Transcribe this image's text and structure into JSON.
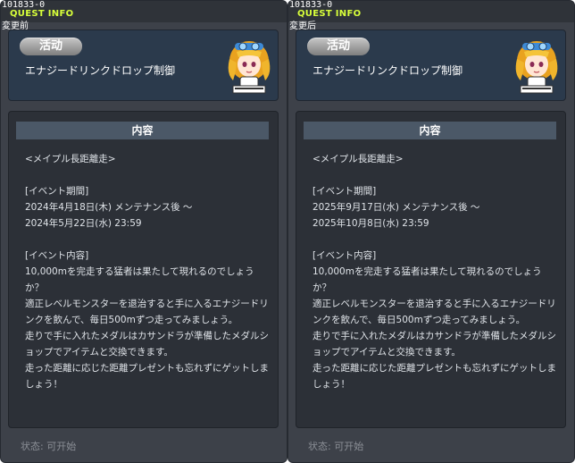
{
  "panels": [
    {
      "quest_id": "101833-0",
      "header_label": "QUEST INFO",
      "change_tag": "変更前",
      "status_pill": "活动",
      "quest_title": "エナジードリンクドロップ制御",
      "content_header": "内容",
      "content_text": "<メイプル長距離走>\n\n[イベント期間]\n2024年4月18日(木) メンテナンス後 ～\n2024年5月22日(水) 23:59\n\n[イベント内容]\n10,000mを完走する猛者は果たして現れるのでしょうか？\n適正レベルモンスターを退治すると手に入るエナジードリンクを飲んで、毎日500mずつ走ってみましょう。\n走りで手に入れたメダルはカサンドラが準備したメダルショップでアイテムと交換できます。\n走った距離に応じた距離プレゼントも忘れずにゲットしましょう！",
      "footer_status": "状态:  可开始"
    },
    {
      "quest_id": "101833-0",
      "header_label": "QUEST INFO",
      "change_tag": "変更后",
      "status_pill": "活动",
      "quest_title": "エナジードリンクドロップ制御",
      "content_header": "内容",
      "content_text": "<メイプル長距離走>\n\n[イベント期間]\n2025年9月17日(水) メンテナンス後 ～\n2025年10月8日(水) 23:59\n\n[イベント内容]\n10,000mを完走する猛者は果たして現れるのでしょうか？\n適正レベルモンスターを退治すると手に入るエナジードリンクを飲んで、毎日500mずつ走ってみましょう。\n走りで手に入れたメダルはカサンドラが準備したメダルショップでアイテムと交換できます。\n走った距離に応じた距離プレゼントも忘れずにゲットしましょう！",
      "footer_status": "状态:  可开始"
    }
  ],
  "colors": {
    "header_accent": "#d8ff3a",
    "panel_bg": "#3d4149",
    "title_box_bg": "#2b3a4c",
    "content_box_bg": "#2c3037",
    "content_header_bg": "#4b5867"
  },
  "icons": {
    "npc": "npc-portrait-icon"
  }
}
